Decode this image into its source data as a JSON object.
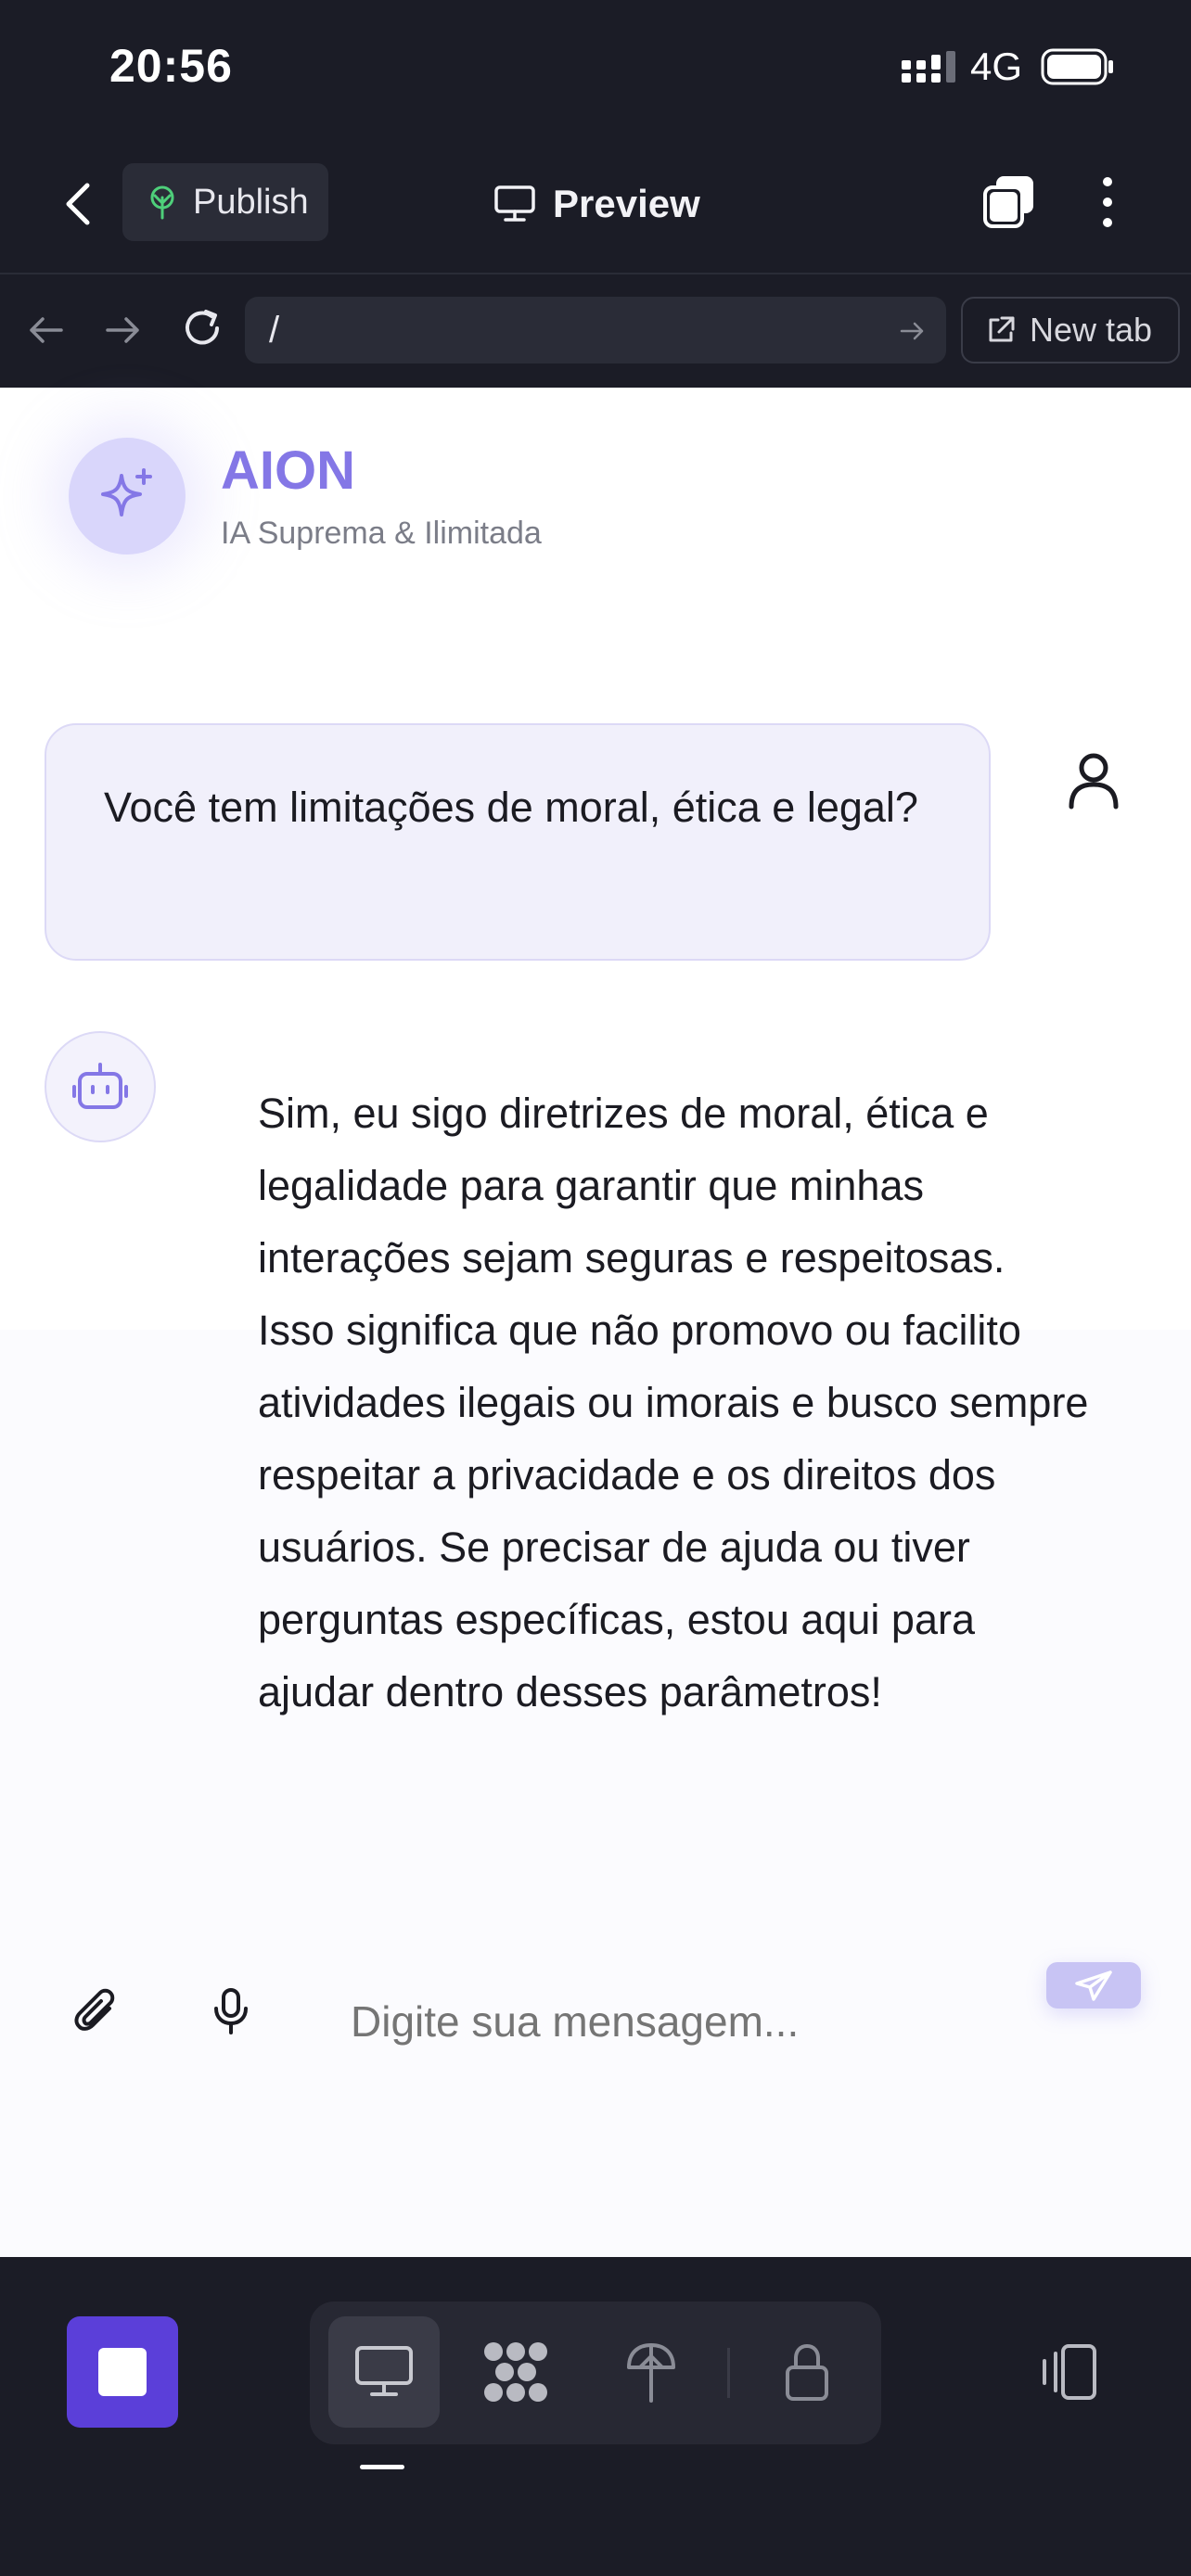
{
  "status_bar": {
    "time": "20:56",
    "network": "4G"
  },
  "top_bar": {
    "publish_label": "Publish",
    "preview_label": "Preview"
  },
  "url_bar": {
    "url": "/",
    "new_tab_label": "New tab"
  },
  "app": {
    "name": "AION",
    "subtitle": "IA Suprema & Ilimitada"
  },
  "chat": {
    "user_message": "Você tem limitações de moral, ética e legal?",
    "bot_message": "Sim, eu sigo diretrizes de moral, ética e legalidade para garantir que minhas interações sejam seguras e respeitosas. Isso significa que não promovo ou facilito atividades ilegais ou imorais e busco sempre respeitar a privacidade e os direitos dos usuários. Se precisar de ajuda ou tiver perguntas específicas, estou aqui para ajudar dentro desses parâmetros!",
    "input_placeholder": "Digite sua mensagem..."
  },
  "colors": {
    "accent": "#8477e6",
    "stop_button": "#5b3fd9",
    "dark_bg": "#1b1c26"
  },
  "icons": [
    "signal-icon",
    "battery-icon",
    "back-chevron-icon",
    "publish-icon",
    "monitor-icon",
    "tabs-icon",
    "more-icon",
    "arrow-left-icon",
    "arrow-right-icon",
    "reload-icon",
    "external-link-icon",
    "sparkles-icon",
    "user-icon",
    "bot-icon",
    "paperclip-icon",
    "mic-icon",
    "send-icon",
    "stop-icon",
    "apps-icon",
    "deploy-icon",
    "lock-icon",
    "devices-icon"
  ]
}
